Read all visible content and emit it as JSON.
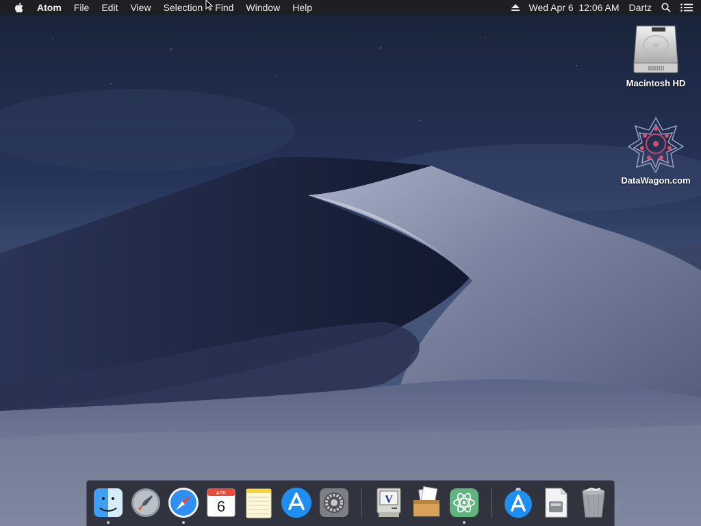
{
  "menubar": {
    "app_name": "Atom",
    "items": [
      "File",
      "Edit",
      "View",
      "Selection",
      "Find",
      "Window",
      "Help"
    ],
    "clock": "Wed Apr 6  12:06 AM",
    "user": "Dartz"
  },
  "desktop": {
    "icons": [
      {
        "label": "Macintosh HD",
        "icon": "hard-drive-icon"
      },
      {
        "label": "DataWagon.com",
        "icon": "datawagon-icon"
      }
    ]
  },
  "dock": {
    "items": [
      {
        "name": "Finder",
        "icon": "finder-icon",
        "running": true
      },
      {
        "name": "Launchpad",
        "icon": "launchpad-icon",
        "running": false
      },
      {
        "name": "Safari",
        "icon": "safari-icon",
        "running": true
      },
      {
        "name": "Calendar",
        "icon": "calendar-icon",
        "running": false,
        "month": "APR",
        "day": "6"
      },
      {
        "name": "Notes",
        "icon": "notes-icon",
        "running": false
      },
      {
        "name": "App Store",
        "icon": "app-store-icon",
        "running": false
      },
      {
        "name": "System Preferences",
        "icon": "system-preferences-icon",
        "running": false
      },
      {
        "name": "Vim",
        "icon": "vim-icon",
        "running": false
      },
      {
        "name": "Archive Utility",
        "icon": "archive-icon",
        "running": false
      },
      {
        "name": "Atom",
        "icon": "atom-icon",
        "running": true
      },
      {
        "name": "Downloads",
        "icon": "downloads-app-store-icon",
        "running": false
      },
      {
        "name": "Documents",
        "icon": "document-icon",
        "running": false
      },
      {
        "name": "Trash",
        "icon": "trash-icon",
        "running": false
      }
    ]
  },
  "colors": {
    "menubar_bg": "#1e1f22",
    "sky_top": "#1c2742",
    "sky_bottom": "#4a5a78",
    "dune_light": "#8e95ad",
    "dune_shadow": "#1a2340"
  }
}
